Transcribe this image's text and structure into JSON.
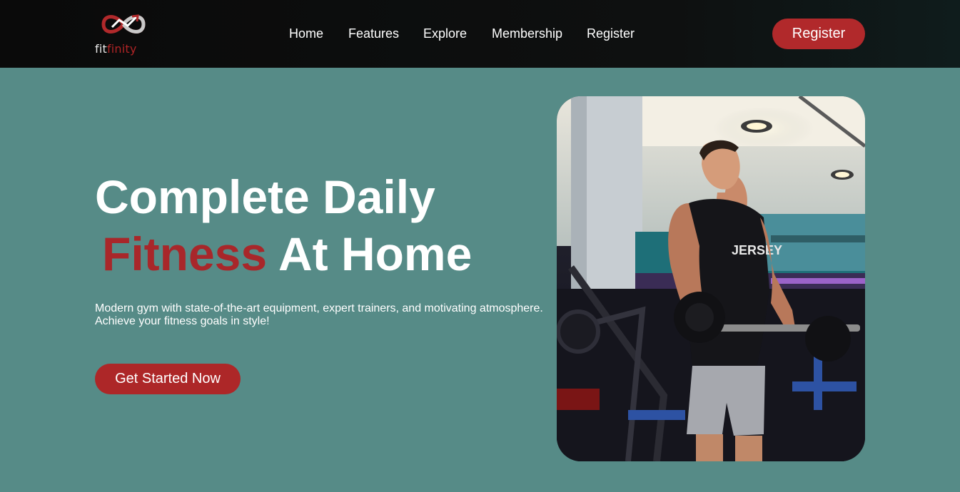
{
  "brand": {
    "name_part1": "fit",
    "name_part2": "finity",
    "logo_icon": "infinity-arrow-icon"
  },
  "nav": {
    "links": [
      "Home",
      "Features",
      "Explore",
      "Membership",
      "Register"
    ],
    "register_button": "Register"
  },
  "hero": {
    "title_line1": "Complete Daily",
    "title_accent": "Fitness",
    "title_line2_rest": "At Home",
    "description_line1": "Modern gym with state-of-the-art equipment, expert trainers, and motivating atmosphere.",
    "description_line2": "Achieve your fitness goals in style!",
    "cta_label": "Get Started Now",
    "image_subject": "man lifting barbell in gym",
    "shirt_text": "JERSEY"
  },
  "colors": {
    "background": "#568b87",
    "navbar": "#0a0a0a",
    "accent": "#b1292b",
    "text": "#ffffff"
  }
}
